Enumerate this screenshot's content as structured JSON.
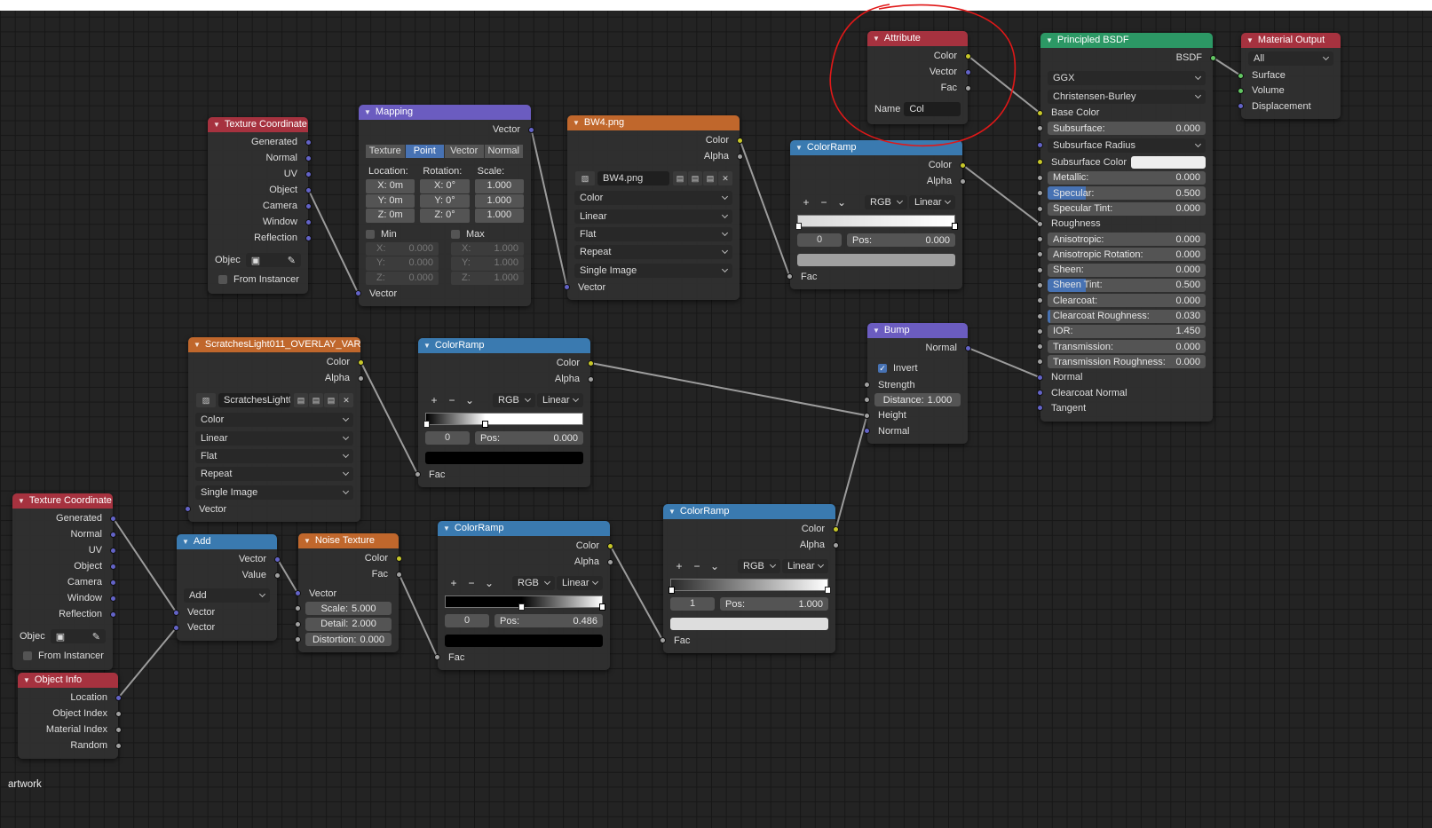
{
  "canvas_label": "artwork",
  "socket_colors": {
    "color": "#c7c729",
    "float": "#a1a1a1",
    "vector": "#6363c7",
    "shader": "#63c763"
  },
  "nodes": [
    {
      "id": "tc1",
      "title": "Texture Coordinate",
      "header_color": "#a6323f",
      "rows": [
        {
          "t": "out",
          "label": "Generated",
          "sock": "vector"
        },
        {
          "t": "out",
          "label": "Normal",
          "sock": "vector"
        },
        {
          "t": "out",
          "label": "UV",
          "sock": "vector"
        },
        {
          "t": "out",
          "label": "Object",
          "sock": "vector"
        },
        {
          "t": "out",
          "label": "Camera",
          "sock": "vector"
        },
        {
          "t": "out",
          "label": "Window",
          "sock": "vector"
        },
        {
          "t": "out",
          "label": "Reflection",
          "sock": "vector"
        },
        {
          "t": "object",
          "label": "Objec"
        },
        {
          "t": "check",
          "label": "From Instancer",
          "checked": false
        }
      ]
    },
    {
      "id": "mapping",
      "title": "Mapping",
      "header_color": "#6b5cc0",
      "rows": [
        {
          "t": "out",
          "label": "Vector",
          "sock": "vector"
        },
        {
          "t": "seg",
          "options": [
            "Texture",
            "Point",
            "Vector",
            "Normal"
          ],
          "active": 1
        },
        {
          "t": "vecgrid",
          "headers": [
            "Location:",
            "Rotation:",
            "Scale:"
          ],
          "cols": [
            [
              "X: 0m",
              "Y: 0m",
              "Z: 0m"
            ],
            [
              "X:   0°",
              "Y:   0°",
              "Z:   0°"
            ],
            [
              "1.000",
              "1.000",
              "1.000"
            ]
          ]
        },
        {
          "t": "minmax",
          "min_label": "Min",
          "max_label": "Max",
          "axes": [
            "X:",
            "Y:",
            "Z:"
          ],
          "min": [
            "0.000",
            "0.000",
            "0.000"
          ],
          "max": [
            "1.000",
            "1.000",
            "1.000"
          ]
        },
        {
          "t": "in",
          "label": "Vector",
          "sock": "vector"
        }
      ]
    },
    {
      "id": "bw4",
      "title": "BW4.png",
      "header_color": "#c0672c",
      "rows": [
        {
          "t": "out",
          "label": "Color",
          "sock": "color"
        },
        {
          "t": "out",
          "label": "Alpha",
          "sock": "float"
        },
        {
          "t": "image",
          "value": "BW4.png"
        },
        {
          "t": "dd",
          "value": "Color"
        },
        {
          "t": "dd",
          "value": "Linear"
        },
        {
          "t": "dd",
          "value": "Flat"
        },
        {
          "t": "dd",
          "value": "Repeat"
        },
        {
          "t": "dd",
          "value": "Single Image"
        },
        {
          "t": "in",
          "label": "Vector",
          "sock": "vector"
        }
      ]
    },
    {
      "id": "cr1",
      "title": "ColorRamp",
      "header_color": "#3a7ab0",
      "rows": [
        {
          "t": "out",
          "label": "Color",
          "sock": "color"
        },
        {
          "t": "out",
          "label": "Alpha",
          "sock": "float"
        },
        {
          "t": "tools",
          "mode": "RGB",
          "interp": "Linear"
        },
        {
          "t": "bar",
          "stops": [
            {
              "pos": 0.0,
              "color": "#d8d8d8"
            },
            {
              "pos": 1.0,
              "color": "#ffffff"
            }
          ],
          "selected": 0
        },
        {
          "t": "pos",
          "index": "0",
          "pos_label": "Pos:",
          "pos": "0.000"
        },
        {
          "t": "swatch",
          "color": "#a0a0a0"
        },
        {
          "t": "in",
          "label": "Fac",
          "sock": "float"
        }
      ]
    },
    {
      "id": "attr",
      "title": "Attribute",
      "header_color": "#a6323f",
      "rows": [
        {
          "t": "out",
          "label": "Color",
          "sock": "color"
        },
        {
          "t": "out",
          "label": "Vector",
          "sock": "vector"
        },
        {
          "t": "out",
          "label": "Fac",
          "sock": "float"
        },
        {
          "t": "name",
          "label": "Name",
          "value": "Col"
        }
      ]
    },
    {
      "id": "bsdf",
      "title": "Principled BSDF",
      "header_color": "#2c9865",
      "rows": [
        {
          "t": "out",
          "label": "BSDF",
          "sock": "shader"
        },
        {
          "t": "dd",
          "value": "GGX"
        },
        {
          "t": "dd",
          "value": "Christensen-Burley"
        },
        {
          "t": "in",
          "label": "Base Color",
          "sock": "color"
        },
        {
          "t": "field",
          "label": "Subsurface:",
          "value": "0.000",
          "sock": "float"
        },
        {
          "t": "dd",
          "value": "Subsurface Radius",
          "sock": "vector"
        },
        {
          "t": "color",
          "label": "Subsurface Color",
          "sock": "color",
          "swatch": "#eeeeee"
        },
        {
          "t": "field",
          "label": "Metallic:",
          "value": "0.000",
          "sock": "float"
        },
        {
          "t": "field",
          "label": "Specular:",
          "value": "0.500",
          "sock": "float",
          "fill": 0.5
        },
        {
          "t": "field",
          "label": "Specular Tint:",
          "value": "0.000",
          "sock": "float"
        },
        {
          "t": "in",
          "label": "Roughness",
          "sock": "float"
        },
        {
          "t": "field",
          "label": "Anisotropic:",
          "value": "0.000",
          "sock": "float"
        },
        {
          "t": "field",
          "label": "Anisotropic Rotation:",
          "value": "0.000",
          "sock": "float"
        },
        {
          "t": "field",
          "label": "Sheen:",
          "value": "0.000",
          "sock": "float"
        },
        {
          "t": "field",
          "label": "Sheen Tint:",
          "value": "0.500",
          "sock": "float",
          "fill": 0.5
        },
        {
          "t": "field",
          "label": "Clearcoat:",
          "value": "0.000",
          "sock": "float"
        },
        {
          "t": "field",
          "label": "Clearcoat Roughness:",
          "value": "0.030",
          "sock": "float",
          "fill": 0.03
        },
        {
          "t": "field",
          "label": "IOR:",
          "value": "1.450",
          "sock": "float"
        },
        {
          "t": "field",
          "label": "Transmission:",
          "value": "0.000",
          "sock": "float"
        },
        {
          "t": "field",
          "label": "Transmission Roughness:",
          "value": "0.000",
          "sock": "float"
        },
        {
          "t": "in",
          "label": "Normal",
          "sock": "vector"
        },
        {
          "t": "in",
          "label": "Clearcoat Normal",
          "sock": "vector"
        },
        {
          "t": "in",
          "label": "Tangent",
          "sock": "vector"
        }
      ]
    },
    {
      "id": "matout",
      "title": "Material Output",
      "header_color": "#a6323f",
      "rows": [
        {
          "t": "dd",
          "value": "All"
        },
        {
          "t": "in",
          "label": "Surface",
          "sock": "shader"
        },
        {
          "t": "in",
          "label": "Volume",
          "sock": "shader"
        },
        {
          "t": "in",
          "label": "Displacement",
          "sock": "vector"
        }
      ]
    },
    {
      "id": "scr",
      "title": "ScratchesLight011_OVERLAY_VAR2_...",
      "header_color": "#c0672c",
      "rows": [
        {
          "t": "out",
          "label": "Color",
          "sock": "color"
        },
        {
          "t": "out",
          "label": "Alpha",
          "sock": "float"
        },
        {
          "t": "image",
          "value": "ScratchesLight0..."
        },
        {
          "t": "dd",
          "value": "Color"
        },
        {
          "t": "dd",
          "value": "Linear"
        },
        {
          "t": "dd",
          "value": "Flat"
        },
        {
          "t": "dd",
          "value": "Repeat"
        },
        {
          "t": "dd",
          "value": "Single Image"
        },
        {
          "t": "in",
          "label": "Vector",
          "sock": "vector"
        }
      ]
    },
    {
      "id": "cr2",
      "title": "ColorRamp",
      "header_color": "#3a7ab0",
      "rows": [
        {
          "t": "out",
          "label": "Color",
          "sock": "color"
        },
        {
          "t": "out",
          "label": "Alpha",
          "sock": "float"
        },
        {
          "t": "tools",
          "mode": "RGB",
          "interp": "Linear"
        },
        {
          "t": "bar",
          "stops": [
            {
              "pos": 0.0,
              "color": "#000000"
            },
            {
              "pos": 0.38,
              "color": "#ffffff"
            }
          ],
          "selected": 0
        },
        {
          "t": "pos",
          "index": "0",
          "pos_label": "Pos:",
          "pos": "0.000"
        },
        {
          "t": "swatch",
          "color": "#000000"
        },
        {
          "t": "in",
          "label": "Fac",
          "sock": "float"
        }
      ]
    },
    {
      "id": "bump",
      "title": "Bump",
      "header_color": "#6b5cc0",
      "rows": [
        {
          "t": "out",
          "label": "Normal",
          "sock": "vector"
        },
        {
          "t": "check",
          "label": "Invert",
          "checked": true
        },
        {
          "t": "in",
          "label": "Strength",
          "sock": "float"
        },
        {
          "t": "field",
          "label": "Distance:",
          "value": "1.000",
          "sock": "float",
          "center": true
        },
        {
          "t": "in",
          "label": "Height",
          "sock": "float"
        },
        {
          "t": "in",
          "label": "Normal",
          "sock": "vector"
        }
      ]
    },
    {
      "id": "tc2",
      "title": "Texture Coordinate",
      "header_color": "#a6323f",
      "rows": [
        {
          "t": "out",
          "label": "Generated",
          "sock": "vector"
        },
        {
          "t": "out",
          "label": "Normal",
          "sock": "vector"
        },
        {
          "t": "out",
          "label": "UV",
          "sock": "vector"
        },
        {
          "t": "out",
          "label": "Object",
          "sock": "vector"
        },
        {
          "t": "out",
          "label": "Camera",
          "sock": "vector"
        },
        {
          "t": "out",
          "label": "Window",
          "sock": "vector"
        },
        {
          "t": "out",
          "label": "Reflection",
          "sock": "vector"
        },
        {
          "t": "object",
          "label": "Objec"
        },
        {
          "t": "check",
          "label": "From Instancer",
          "checked": false
        }
      ]
    },
    {
      "id": "add",
      "title": "Add",
      "header_color": "#3a7ab0",
      "rows": [
        {
          "t": "out",
          "label": "Vector",
          "sock": "vector"
        },
        {
          "t": "out",
          "label": "Value",
          "sock": "float"
        },
        {
          "t": "dd",
          "value": "Add"
        },
        {
          "t": "in",
          "label": "Vector",
          "sock": "vector"
        },
        {
          "t": "in",
          "label": "Vector",
          "sock": "vector"
        }
      ]
    },
    {
      "id": "noise",
      "title": "Noise Texture",
      "header_color": "#c0672c",
      "rows": [
        {
          "t": "out",
          "label": "Color",
          "sock": "color"
        },
        {
          "t": "out",
          "label": "Fac",
          "sock": "float"
        },
        {
          "t": "in",
          "label": "Vector",
          "sock": "vector"
        },
        {
          "t": "field",
          "label": "Scale:",
          "value": "5.000",
          "sock": "float",
          "center": true
        },
        {
          "t": "field",
          "label": "Detail:",
          "value": "2.000",
          "sock": "float",
          "center": true
        },
        {
          "t": "field",
          "label": "Distortion:",
          "value": "0.000",
          "sock": "float",
          "center": true
        }
      ]
    },
    {
      "id": "cr3",
      "title": "ColorRamp",
      "header_color": "#3a7ab0",
      "rows": [
        {
          "t": "out",
          "label": "Color",
          "sock": "color"
        },
        {
          "t": "out",
          "label": "Alpha",
          "sock": "float"
        },
        {
          "t": "tools",
          "mode": "RGB",
          "interp": "Linear"
        },
        {
          "t": "bar",
          "stops": [
            {
              "pos": 0.486,
              "color": "#000000"
            },
            {
              "pos": 1.0,
              "color": "#ffffff"
            }
          ],
          "selected": 0
        },
        {
          "t": "pos",
          "index": "0",
          "pos_label": "Pos:",
          "pos": "0.486"
        },
        {
          "t": "swatch",
          "color": "#000000"
        },
        {
          "t": "in",
          "label": "Fac",
          "sock": "float"
        }
      ]
    },
    {
      "id": "cr4",
      "title": "ColorRamp",
      "header_color": "#3a7ab0",
      "rows": [
        {
          "t": "out",
          "label": "Color",
          "sock": "color"
        },
        {
          "t": "out",
          "label": "Alpha",
          "sock": "float"
        },
        {
          "t": "tools",
          "mode": "RGB",
          "interp": "Linear"
        },
        {
          "t": "bar",
          "stops": [
            {
              "pos": 0.0,
              "color": "#2a2a2a"
            },
            {
              "pos": 1.0,
              "color": "#ffffff"
            }
          ],
          "selected": 1
        },
        {
          "t": "pos",
          "index": "1",
          "pos_label": "Pos:",
          "pos": "1.000"
        },
        {
          "t": "swatch",
          "color": "#dddddd"
        },
        {
          "t": "in",
          "label": "Fac",
          "sock": "float"
        }
      ]
    },
    {
      "id": "objinfo",
      "title": "Object Info",
      "header_color": "#a6323f",
      "rows": [
        {
          "t": "out",
          "label": "Location",
          "sock": "vector"
        },
        {
          "t": "out",
          "label": "Object Index",
          "sock": "float"
        },
        {
          "t": "out",
          "label": "Material Index",
          "sock": "float"
        },
        {
          "t": "out",
          "label": "Random",
          "sock": "float"
        }
      ]
    }
  ],
  "links": [
    {
      "from": [
        "tc1",
        3
      ],
      "to": [
        "mapping",
        4
      ]
    },
    {
      "from": [
        "mapping",
        0
      ],
      "to": [
        "bw4",
        8
      ]
    },
    {
      "from": [
        "bw4",
        0
      ],
      "to": [
        "cr1",
        6
      ]
    },
    {
      "from": [
        "cr1",
        0
      ],
      "to": [
        "bsdf",
        10
      ]
    },
    {
      "from": [
        "attr",
        0
      ],
      "to": [
        "bsdf",
        3
      ]
    },
    {
      "from": [
        "bsdf",
        0
      ],
      "to": [
        "matout",
        1
      ]
    },
    {
      "from": [
        "scr",
        0
      ],
      "to": [
        "cr2",
        6
      ]
    },
    {
      "from": [
        "cr2",
        0
      ],
      "to": [
        "bump",
        4
      ]
    },
    {
      "from": [
        "cr4",
        0
      ],
      "to": [
        "bump",
        4
      ]
    },
    {
      "from": [
        "bump",
        0
      ],
      "to": [
        "bsdf",
        20
      ]
    },
    {
      "from": [
        "tc2",
        0
      ],
      "to": [
        "add",
        3
      ]
    },
    {
      "from": [
        "objinfo",
        0
      ],
      "to": [
        "add",
        4
      ]
    },
    {
      "from": [
        "add",
        0
      ],
      "to": [
        "noise",
        2
      ]
    },
    {
      "from": [
        "noise",
        1
      ],
      "to": [
        "cr3",
        6
      ]
    },
    {
      "from": [
        "cr3",
        0
      ],
      "to": [
        "cr4",
        6
      ]
    }
  ],
  "annotation": {
    "type": "hand-drawn circle",
    "target": "attr",
    "color": "#e01818"
  }
}
